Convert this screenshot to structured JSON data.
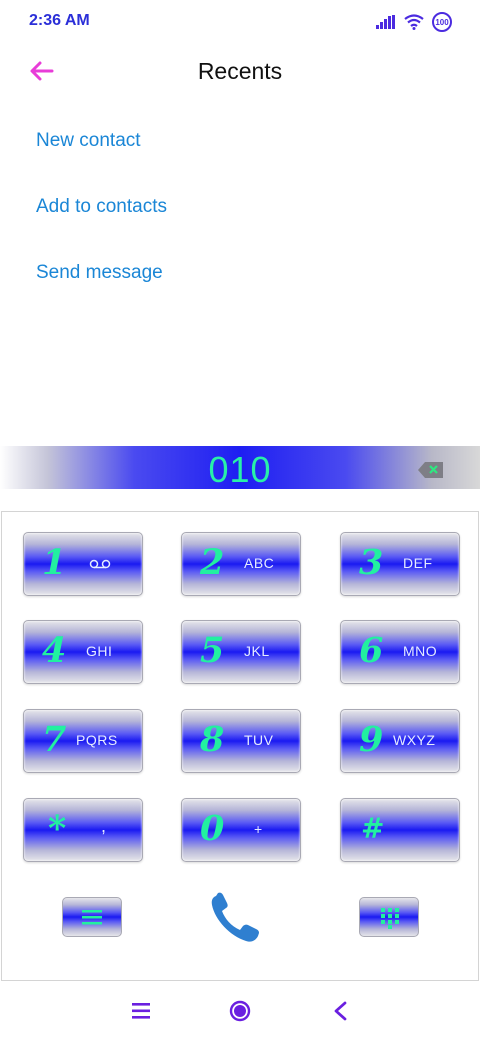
{
  "status": {
    "time": "2:36 AM",
    "battery": "100"
  },
  "header": {
    "title": "Recents"
  },
  "menu": {
    "items": [
      "New contact",
      "Add to contacts",
      "Send message"
    ]
  },
  "dialer": {
    "number": "010",
    "keys": [
      {
        "digit": "1",
        "letters": ""
      },
      {
        "digit": "2",
        "letters": "ABC"
      },
      {
        "digit": "3",
        "letters": "DEF"
      },
      {
        "digit": "4",
        "letters": "GHI"
      },
      {
        "digit": "5",
        "letters": "JKL"
      },
      {
        "digit": "6",
        "letters": "MNO"
      },
      {
        "digit": "7",
        "letters": "PQRS"
      },
      {
        "digit": "8",
        "letters": "TUV"
      },
      {
        "digit": "9",
        "letters": "WXYZ"
      },
      {
        "digit": "*",
        "letters": ","
      },
      {
        "digit": "0",
        "letters": "+"
      },
      {
        "digit": "#",
        "letters": ""
      }
    ]
  },
  "colors": {
    "accent": "#2b2fd8",
    "link": "#1a86d6",
    "digit": "#22f0a0",
    "back_arrow": "#e83cd8",
    "call": "#2f7fd0",
    "nav": "#6a1fe0"
  },
  "icons": [
    "back-arrow-icon",
    "voicemail-icon",
    "backspace-icon",
    "menu-icon",
    "phone-icon",
    "dialpad-icon",
    "nav-menu-icon",
    "nav-home-icon",
    "nav-back-icon"
  ]
}
